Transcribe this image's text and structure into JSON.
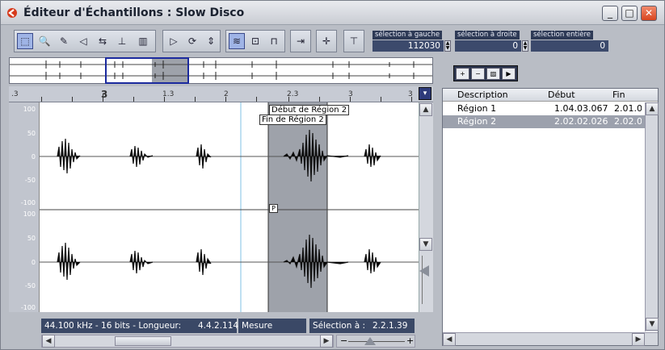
{
  "window": {
    "title": "Éditeur d'Échantillons : Slow Disco",
    "minimize": "_",
    "maximize": "□",
    "close": "✕"
  },
  "toolbar": {
    "tools": [
      {
        "name": "range-select-tool-icon",
        "glyph": "⬚",
        "on": true
      },
      {
        "name": "zoom-tool-icon",
        "glyph": "🔍",
        "on": false
      },
      {
        "name": "draw-tool-icon",
        "glyph": "✎",
        "on": false
      },
      {
        "name": "audition-tool-icon",
        "glyph": "◁",
        "on": false
      },
      {
        "name": "scrub-tool-icon",
        "glyph": "⇆",
        "on": false
      },
      {
        "name": "time-warp-tool-icon",
        "glyph": "⊥",
        "on": false
      },
      {
        "name": "grid-icon",
        "glyph": "▥",
        "on": false
      }
    ],
    "play_group": [
      {
        "name": "play-icon",
        "glyph": "▷"
      },
      {
        "name": "loop-icon",
        "glyph": "⟳"
      },
      {
        "name": "level-icon",
        "glyph": "⇕"
      }
    ],
    "view_group": [
      {
        "name": "waveform-view-icon",
        "glyph": "≋",
        "on": true
      },
      {
        "name": "snap-icon",
        "glyph": "⊡",
        "on": false
      },
      {
        "name": "region-marker-icon",
        "glyph": "⊓",
        "on": false
      }
    ],
    "sel_left_label": "sélection à gauche",
    "sel_left_value": "112030",
    "sel_right_label": "sélection à droite",
    "sel_right_value": "0",
    "sel_all_label": "sélection entière",
    "sel_all_value": "0"
  },
  "ruler": {
    "labels": [
      ".3",
      "3",
      "1.3",
      "2",
      "2.3",
      "3",
      "3"
    ],
    "bold": [
      false,
      true,
      false,
      false,
      false,
      false,
      false
    ]
  },
  "markers": {
    "region_start": "Début de Région 2",
    "region_end": "Fin de Région 2",
    "p_marker": "P"
  },
  "y_axis": {
    "top": [
      "100",
      "50",
      "0",
      "-50",
      "-100"
    ],
    "bottom": [
      "100",
      "50",
      "0",
      "-50",
      "-100"
    ]
  },
  "status": {
    "format": "44.100 kHz - 16 bits - Longueur:",
    "length": "4.4.2.114",
    "unit": "Mesure",
    "sel_label": "Sélection à :",
    "sel_value": "2.2.1.39"
  },
  "regions": {
    "columns": [
      "Description",
      "Début",
      "Fin"
    ],
    "rows": [
      {
        "description": "Région 1",
        "start": "1.04.03.067",
        "end": "2.01.0",
        "selected": false
      },
      {
        "description": "Région 2",
        "start": "2.02.02.026",
        "end": "2.02.0",
        "selected": true
      }
    ]
  },
  "colors": {
    "accent": "#1b2a9e",
    "selection_shade": "#9ea2aa",
    "status_bg": "#3a4866"
  }
}
